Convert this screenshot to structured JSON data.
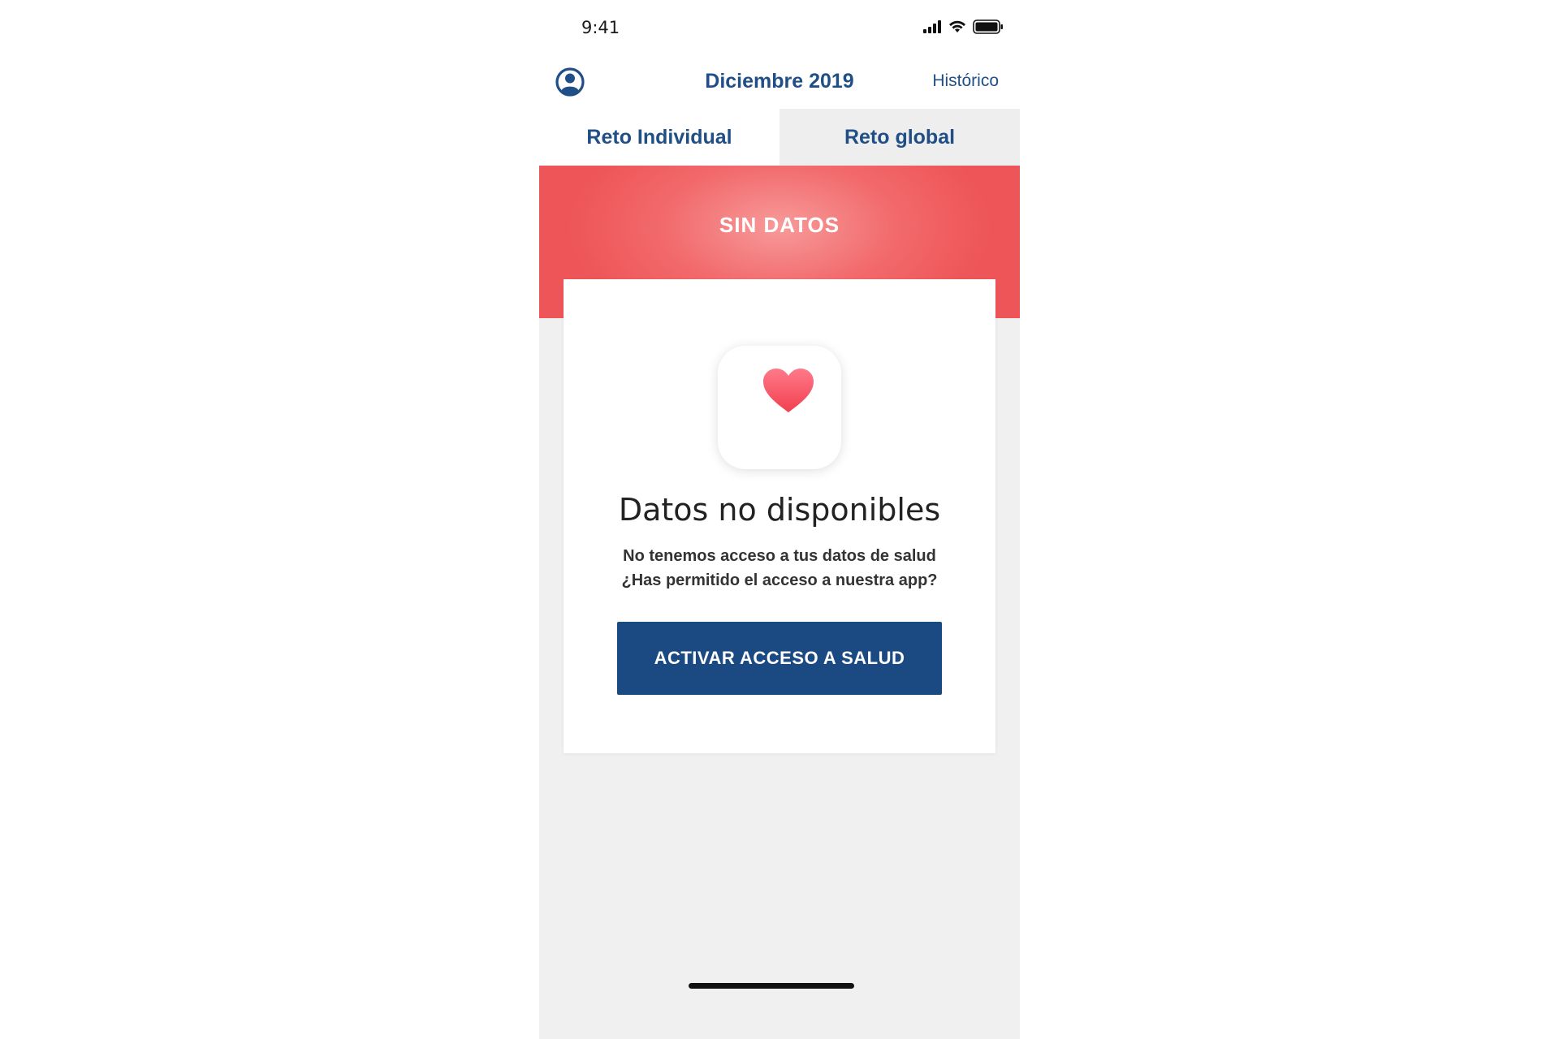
{
  "status_bar": {
    "time": "9:41",
    "icons": [
      "signal-icon",
      "wifi-icon",
      "battery-icon"
    ]
  },
  "header": {
    "title": "Diciembre 2019",
    "history_label": "Histórico",
    "profile_icon": "user-circle-icon"
  },
  "tabs": [
    {
      "label": "Reto Individual",
      "active": true
    },
    {
      "label": "Reto global",
      "active": false
    }
  ],
  "banner": {
    "title": "SIN DATOS"
  },
  "card": {
    "icon": "heart-icon",
    "title": "Datos no disponibles",
    "line1": "No tenemos acceso a tus datos de salud",
    "line2": "¿Has permitido el acceso a nuestra app?",
    "button_label": "ACTIVAR ACCESO A SALUD"
  },
  "colors": {
    "brand_blue": "#1f4f86",
    "button_blue": "#1b4a82",
    "banner_red": "#f26a6c",
    "heart_red": "#f24d63",
    "background_gray": "#f0f0f0"
  }
}
